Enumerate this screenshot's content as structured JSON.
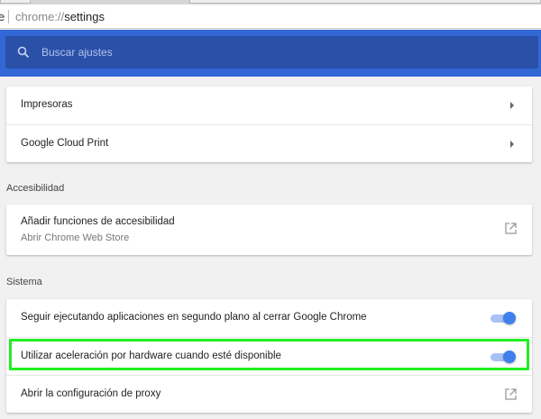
{
  "omnibox": {
    "scheme": "chrome://",
    "path": "settings",
    "prefix": "e"
  },
  "search": {
    "placeholder": "Buscar ajustes"
  },
  "printing": {
    "items": [
      {
        "label": "Impresoras"
      },
      {
        "label": "Google Cloud Print"
      }
    ]
  },
  "accessibility": {
    "heading": "Accesibilidad",
    "item": {
      "label": "Añadir funciones de accesibilidad",
      "sublabel": "Abrir Chrome Web Store"
    }
  },
  "system": {
    "heading": "Sistema",
    "items": [
      {
        "label": "Seguir ejecutando aplicaciones en segundo plano al cerrar Google Chrome",
        "enabled": true
      },
      {
        "label": "Utilizar aceleración por hardware cuando esté disponible",
        "enabled": true
      },
      {
        "label": "Abrir la configuración de proxy"
      }
    ]
  },
  "colors": {
    "header": "#3367d6",
    "highlight": "#22ee22",
    "toggle": "#3f80ed"
  }
}
